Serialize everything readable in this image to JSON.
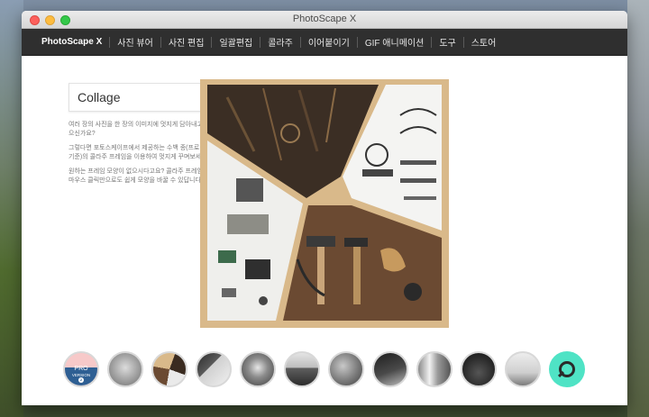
{
  "window": {
    "title": "PhotoScape X"
  },
  "nav": {
    "brand": "PhotoScape X",
    "items": [
      "사진 뷰어",
      "사진 편집",
      "일괄편집",
      "콜라주",
      "이어붙이기",
      "GIF 애니메이션",
      "도구",
      "스토어"
    ]
  },
  "panel": {
    "title": "Collage",
    "paragraphs": [
      "여러 장의 사진을 한 장의 이미지에 멋지게 담아내고 싶으신가요?",
      "그렇다면 포토스케이프에서 제공하는 수백 종(프로버전 기준)의 콜라주 프레임을 이용하여 멋지게 꾸며보세요.",
      "원하는 프레임 모양이 없으시다고요? 콜라주 프레임은 마우스 클릭만으로도 쉽게 모양을 바꿀 수 있답니다."
    ]
  },
  "pro_badge": {
    "line1": "PRO",
    "line2": "VERSION",
    "number": "2"
  },
  "colors": {
    "frame": "#d9b98a",
    "search_button": "#4fe3c5",
    "nav_bg": "#2f2f2f"
  },
  "thumbnails": [
    {
      "name": "pro-version-thumb",
      "style": "pro"
    },
    {
      "name": "thumb-2",
      "style": "gray"
    },
    {
      "name": "thumb-3",
      "style": "collage"
    },
    {
      "name": "thumb-4",
      "style": "dark"
    },
    {
      "name": "thumb-5",
      "style": "portrait"
    },
    {
      "name": "thumb-6",
      "style": "road"
    },
    {
      "name": "thumb-7",
      "style": "gray2"
    },
    {
      "name": "thumb-8",
      "style": "dark2"
    },
    {
      "name": "thumb-9",
      "style": "street"
    },
    {
      "name": "thumb-10",
      "style": "dark3"
    },
    {
      "name": "thumb-11",
      "style": "light"
    },
    {
      "name": "search-thumb",
      "style": "search"
    }
  ]
}
